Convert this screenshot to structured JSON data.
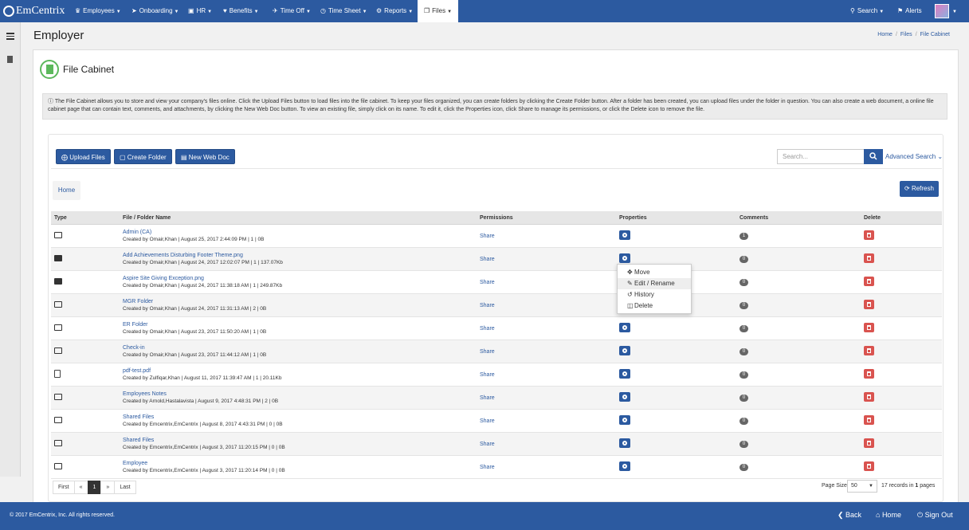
{
  "nav": {
    "brand": "EmCentrix",
    "items": [
      "Employees",
      "Onboarding",
      "HR",
      "Benefits",
      "Time Off",
      "Time Sheet",
      "Reports",
      "Files"
    ],
    "search": "Search",
    "alerts": "Alerts",
    "active": "Files"
  },
  "page": {
    "title": "Employer",
    "breadcrumb": [
      "Home",
      "Files",
      "File Cabinet"
    ]
  },
  "cabinet": {
    "title": "File Cabinet",
    "info": "The File Cabinet allows you to store and view your company's files online. Click the Upload Files button to load files into the file cabinet. To keep your files organized, you can create folders by clicking the Create Folder button. After a folder has been created, you can upload files under the folder in question. You can also create a web document, a online file cabinet page that can contain text, comments, and attachments, by clicking the New Web Doc button. To view an existing file, simply click on its name. To edit it, click the Properties icon, click Share to manage its permissions, or click the Delete icon to remove the file."
  },
  "toolbar": {
    "upload": "Upload Files",
    "create_folder": "Create Folder",
    "new_web_doc": "New Web Doc",
    "search_placeholder": "Search...",
    "advanced_search": "Advanced Search",
    "refresh": "Refresh",
    "home_tab": "Home"
  },
  "table": {
    "headers": [
      "Type",
      "File / Folder Name",
      "Permissions",
      "Properties",
      "Comments",
      "Delete"
    ],
    "rows": [
      {
        "type": "folder",
        "name": "Admin (CA)",
        "meta": "Created by Omair,Khan | August 25, 2017 2:44:09 PM | 1 | 0B",
        "permission": "Share",
        "comments": "1"
      },
      {
        "type": "image",
        "name": "Add Achievements Disturbing Footer Theme.png",
        "meta": "Created by Omair,Khan | August 24, 2017 12:02:07 PM | 1 | 137.07Kb",
        "permission": "Share",
        "comments": "0"
      },
      {
        "type": "image",
        "name": "Aspire Site Giving Exception.png",
        "meta": "Created by Omair,Khan | August 24, 2017 11:38:18 AM | 1 | 249.87Kb",
        "permission": "Share",
        "comments": "0"
      },
      {
        "type": "folder",
        "name": "MGR Folder",
        "meta": "Created by Omair,Khan | August 24, 2017 11:31:13 AM | 2 | 0B",
        "permission": "Share",
        "comments": "0"
      },
      {
        "type": "folder",
        "name": "ER Folder",
        "meta": "Created by Omair,Khan | August 23, 2017 11:50:20 AM | 1 | 0B",
        "permission": "Share",
        "comments": "0"
      },
      {
        "type": "folder",
        "name": "Check-in",
        "meta": "Created by Omair,Khan | August 23, 2017 11:44:12 AM | 1 | 0B",
        "permission": "Share",
        "comments": "0"
      },
      {
        "type": "pdf",
        "name": "pdf-test.pdf",
        "meta": "Created by Zulfiqar,Khan | August 11, 2017 11:39:47 AM | 1 | 20.11Kb",
        "permission": "Share",
        "comments": "0"
      },
      {
        "type": "folder",
        "name": "Employees Notes",
        "meta": "Created by Arnold,Hastalavista | August 9, 2017 4:48:31 PM | 2 | 0B",
        "permission": "Share",
        "comments": "0"
      },
      {
        "type": "folder",
        "name": "Shared Files",
        "meta": "Created by Emcentrix,EmCentrix | August 8, 2017 4:43:31 PM | 0 | 0B",
        "permission": "Share",
        "comments": "0"
      },
      {
        "type": "folder",
        "name": "Shared Files",
        "meta": "Created by Emcentrix,EmCentrix | August 3, 2017 11:20:15 PM | 0 | 0B",
        "permission": "Share",
        "comments": "0"
      },
      {
        "type": "folder",
        "name": "Employee",
        "meta": "Created by Emcentrix,EmCentrix | August 3, 2017 11:20:14 PM | 0 | 0B",
        "permission": "Share",
        "comments": "0"
      }
    ]
  },
  "context_menu": {
    "items": [
      "Move",
      "Edit / Rename",
      "History",
      "Delete"
    ]
  },
  "pager": {
    "first": "First",
    "prev": "«",
    "current": "1",
    "next": "»",
    "last": "Last",
    "page_size_label": "Page Size",
    "page_size": "50",
    "records_a": "17 records in ",
    "records_b": "1",
    "records_c": " pages"
  },
  "footer": {
    "copyright": "© 2017 EmCentrix, Inc. All rights reserved.",
    "back": "Back",
    "home": "Home",
    "sign_out": "Sign Out"
  }
}
